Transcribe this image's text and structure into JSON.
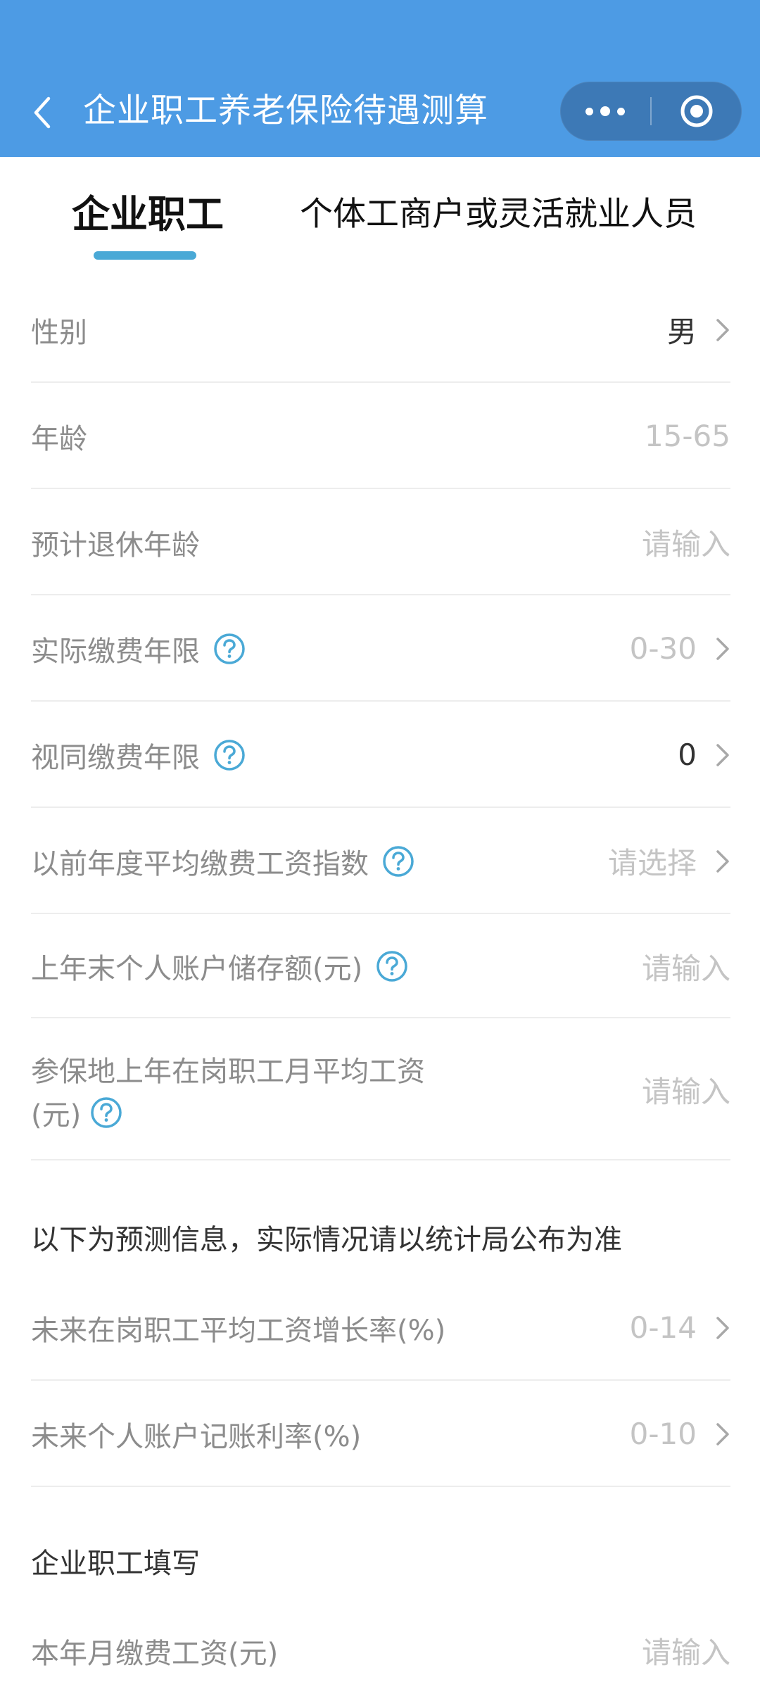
{
  "header": {
    "title": "企业职工养老保险待遇测算",
    "bg_color": "#4d9be4",
    "back_icon": "chevron-left-icon",
    "more_icon": "more-dots-icon",
    "close_icon": "target-close-icon"
  },
  "tabs": {
    "active_label": "企业职工",
    "other_label": "个体工商户或灵活就业人员",
    "underline_color": "#4aa9d6"
  },
  "fields": {
    "gender": {
      "label": "性别",
      "value": "男"
    },
    "age": {
      "label": "年龄",
      "placeholder": "15-65"
    },
    "retire_age": {
      "label": "预计退休年龄",
      "placeholder": "请输入"
    },
    "actual_years": {
      "label": "实际缴费年限",
      "placeholder": "0-30"
    },
    "deemed_years": {
      "label": "视同缴费年限",
      "value": "0"
    },
    "wage_index": {
      "label": "以前年度平均缴费工资指数",
      "placeholder": "请选择"
    },
    "account_balance": {
      "label": "上年末个人账户储存额(元)",
      "placeholder": "请输入"
    },
    "avg_wage": {
      "label_line1": "参保地上年在岗职工月平均工资",
      "label_line2": "(元)",
      "placeholder": "请输入"
    }
  },
  "forecast": {
    "note": "以下为预测信息，实际情况请以统计局公布为准",
    "wage_growth": {
      "label": "未来在岗职工平均工资增长率(%)",
      "placeholder": "0-14"
    },
    "interest_rate": {
      "label": "未来个人账户记账利率(%)",
      "placeholder": "0-10"
    }
  },
  "employee_section": {
    "title": "企业职工填写",
    "monthly_wage": {
      "label": "本年月缴费工资(元)",
      "placeholder": "请输入"
    }
  }
}
